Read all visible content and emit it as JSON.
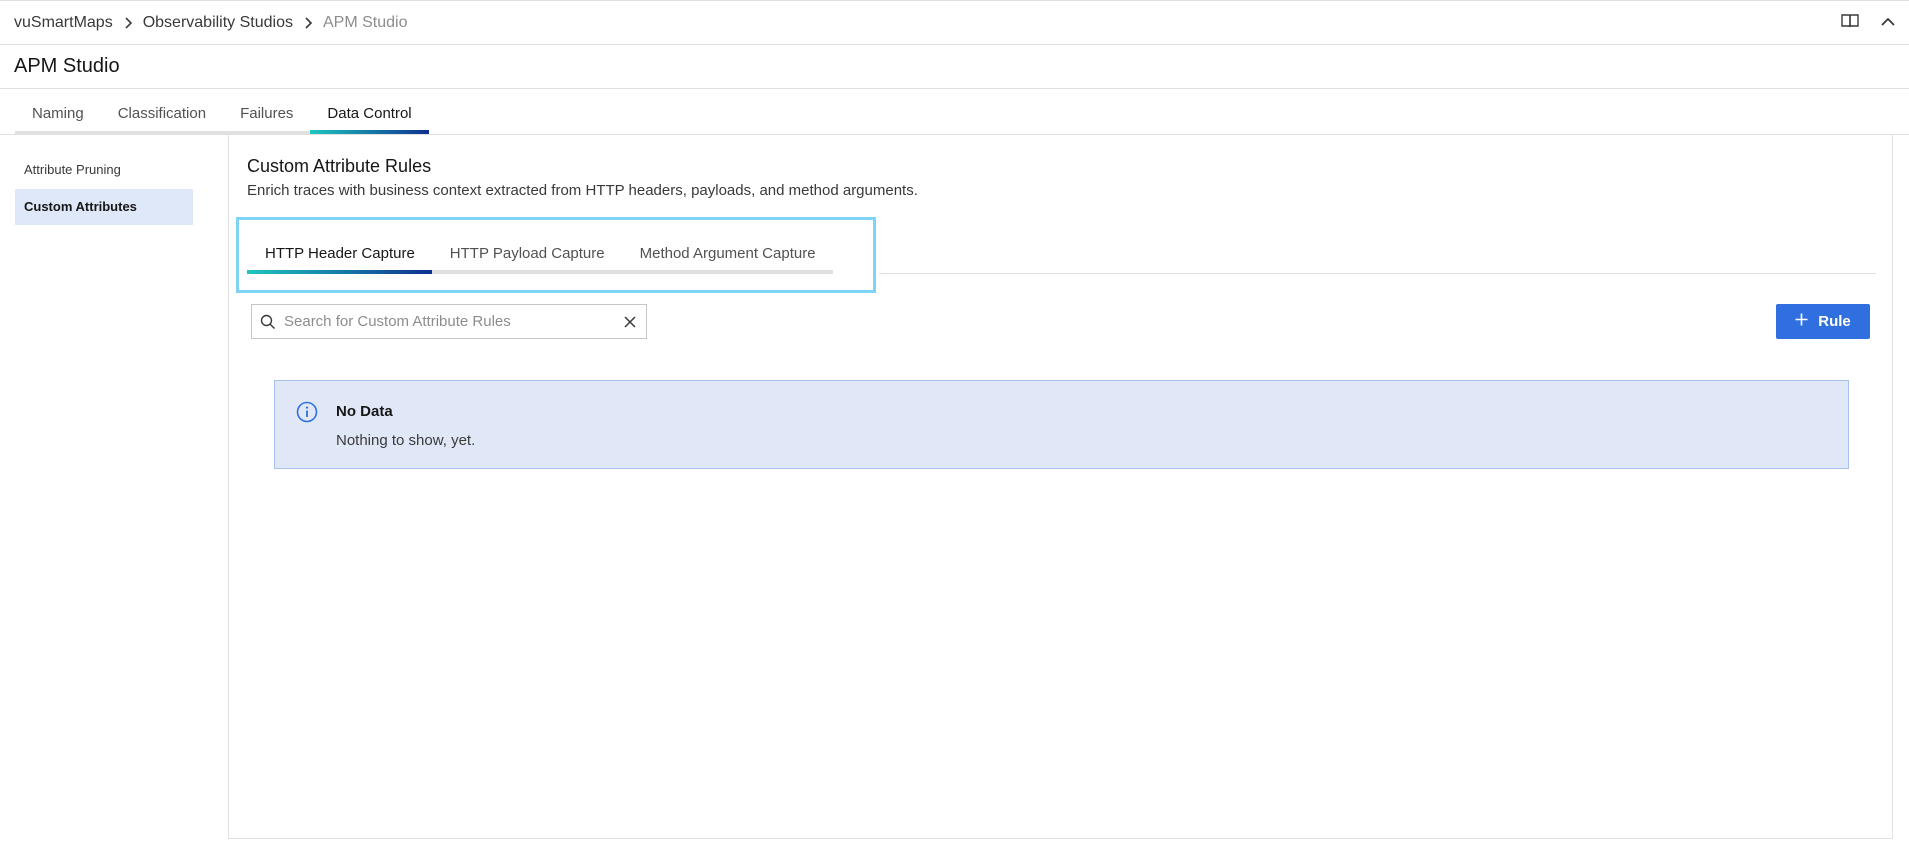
{
  "breadcrumb": {
    "items": [
      {
        "label": "vuSmartMaps"
      },
      {
        "label": "Observability Studios"
      },
      {
        "label": "APM Studio"
      }
    ]
  },
  "header": {
    "title": "APM Studio",
    "icons": [
      "book-icon",
      "chevron-up-icon"
    ]
  },
  "main_tabs": [
    {
      "label": "Naming",
      "active": false
    },
    {
      "label": "Classification",
      "active": false
    },
    {
      "label": "Failures",
      "active": false
    },
    {
      "label": "Data Control",
      "active": true
    }
  ],
  "sidebar": {
    "items": [
      {
        "label": "Attribute Pruning",
        "active": false
      },
      {
        "label": "Custom Attributes",
        "active": true
      }
    ]
  },
  "section": {
    "title": "Custom Attribute Rules",
    "description": "Enrich traces with business context extracted from HTTP headers, payloads, and method arguments."
  },
  "sub_tabs": [
    {
      "label": "HTTP Header Capture",
      "active": true
    },
    {
      "label": "HTTP Payload Capture",
      "active": false
    },
    {
      "label": "Method Argument Capture",
      "active": false
    }
  ],
  "search": {
    "placeholder": "Search for Custom Attribute Rules",
    "value": ""
  },
  "add_rule_button": {
    "label": "Rule",
    "icon": "plus-icon"
  },
  "notice": {
    "icon": "info-icon",
    "title": "No Data",
    "text": "Nothing to show, yet."
  },
  "colors": {
    "accent": "#2f6fe0",
    "tab_gradient_start": "#1ec7c0",
    "tab_gradient_end": "#0f2f8f",
    "highlight_border": "#7fd3f7",
    "notice_bg": "#e0e8f8",
    "sidebar_active_bg": "#dfe8f8"
  }
}
